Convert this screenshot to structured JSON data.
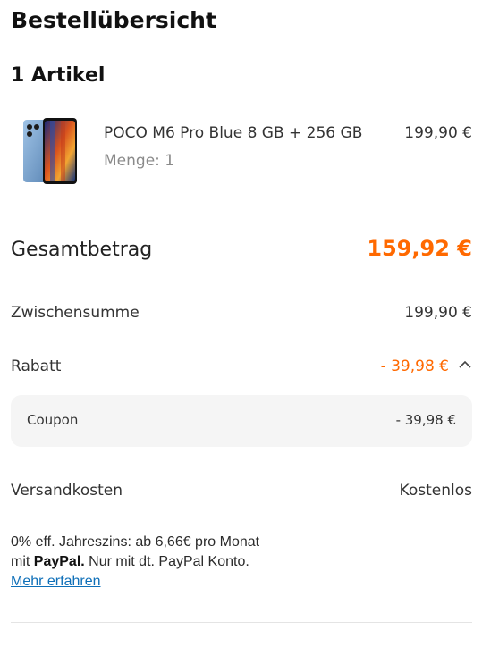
{
  "page": {
    "title": "Bestellübersicht",
    "items_heading": "1 Artikel"
  },
  "product": {
    "name": "POCO M6 Pro Blue 8 GB + 256 GB",
    "qty_label": "Menge:",
    "qty_value": "1",
    "price": "199,90 €",
    "image_icon": "phone-image"
  },
  "summary": {
    "total_label": "Gesamtbetrag",
    "total_value": "159,92 €",
    "subtotal_label": "Zwischensumme",
    "subtotal_value": "199,90 €",
    "discount_label": "Rabatt",
    "discount_value": "- 39,98 €",
    "coupon_label": "Coupon",
    "coupon_value": "- 39,98 €",
    "shipping_label": "Versandkosten",
    "shipping_value": "Kostenlos"
  },
  "paypal": {
    "line1": "0% eff. Jahreszins: ab 6,66€ pro Monat",
    "line2_prefix": "mit",
    "line2_brand": "PayPal.",
    "line2_suffix": "Nur mit dt. PayPal Konto.",
    "link": "Mehr erfahren"
  },
  "colors": {
    "accent": "#ff6900",
    "link": "#0e6fb8"
  }
}
